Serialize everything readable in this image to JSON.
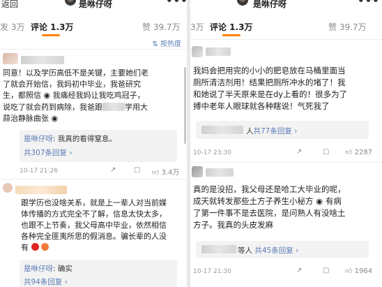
{
  "left": {
    "back": "返回",
    "title": "是咻仔呀",
    "more": "•••",
    "tabs": {
      "repost": "发 3万",
      "comments": "评论 1.3万",
      "likes": "赞 39.7万"
    },
    "sort": "按热度",
    "comment1": {
      "lines": [
        "同意！以及学历高低不是关键，主要她们老",
        "了就会开始信，我妈初中毕业，我爸研究",
        "生，都照信 ◉ 我痛经我妈让我吃鸡冠子，",
        "说吃了就会药到病除，我爸跟",
        "蒜治静脉曲张 ◉"
      ],
      "line4_tail": "学用大",
      "reply_name": "是咻仔呀",
      "reply_text": "我真的看得窒息。",
      "reply_count": "共307条回复",
      "time": "10-17 21:26",
      "likes": "3.4万"
    },
    "comment2": {
      "lines": [
        "跟学历也没啥关系，就是上一辈人对当前媒",
        "体传播的方式完全不了解，信息太快太多，",
        "也跟不上节奏，我父母高中毕业，依然相信",
        "各种完全匪夷所思的假消息。骗长辈的人没",
        "有"
      ],
      "reply_name": "是咻仔呀",
      "reply_text": "确实",
      "reply_count": "共94条回复"
    }
  },
  "right": {
    "title": "是咻仔呀",
    "more": "•••",
    "tabs": {
      "repost": "3万",
      "comments": "评论 1.3万",
      "likes": "赞 39.7万"
    },
    "comment1": {
      "lines": [
        "我妈会把用完的小小的肥皂放在马桶里面当",
        "厕所清洁剂用！结果把厕所冲水的堵了！我",
        "和她说了半天原来是在dy上看的！很多为了",
        "搏中老年人眼球就各种瞎说！气死我了"
      ],
      "reply_prefix": "人",
      "reply_count": "共77条回复",
      "time": "10-17 23:30",
      "likes": "2287"
    },
    "comment2": {
      "lines": [
        "真的是没招，我父母还是哈工大毕业的呢，",
        "成天就转发那些土方子养生小秘方 ◉ 有病",
        "了第一件事不是去医院，是问熟人有没啥土",
        "方子。我真的头皮发麻"
      ],
      "reply_prefix": "等人",
      "reply_count": "共45条回复",
      "time": "10-17 21:30",
      "likes": "1964"
    }
  },
  "colors": {
    "accent": "#ff8200",
    "link": "#5b7cb5",
    "divider": "#e9e9e9"
  }
}
